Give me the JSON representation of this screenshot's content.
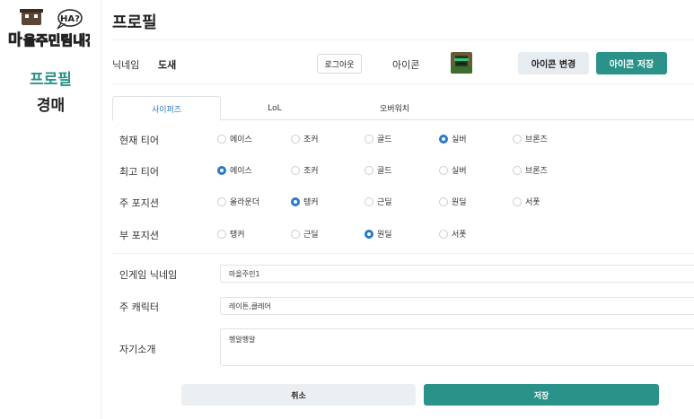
{
  "sidebar": {
    "logo_text": "마을주민팀내전",
    "logo_bubble": "HA?",
    "items": [
      {
        "label": "프로필",
        "active": true
      },
      {
        "label": "경매",
        "active": false
      }
    ],
    "accent": "#2a9288"
  },
  "page": {
    "title": "프로필"
  },
  "profile": {
    "nickname_label": "닉네임",
    "nickname_value": "도새",
    "logout_label": "로그아웃",
    "icon_label": "아이콘",
    "avatar_icon": "character-avatar-icon",
    "change_icon_label": "아이콘 변경",
    "save_icon_label": "아이콘 저장"
  },
  "tabs": [
    {
      "label": "사이퍼즈",
      "active": true
    },
    {
      "label": "LoL",
      "active": false
    },
    {
      "label": "오버워치",
      "active": false
    }
  ],
  "radio_groups": [
    {
      "label": "현재 티어",
      "options": [
        "에이스",
        "조커",
        "골드",
        "실버",
        "브론즈"
      ],
      "selected": "실버"
    },
    {
      "label": "최고 티어",
      "options": [
        "에이스",
        "조커",
        "골드",
        "실버",
        "브론즈"
      ],
      "selected": "에이스"
    },
    {
      "label": "주 포지션",
      "options": [
        "올라운더",
        "탱커",
        "근딜",
        "원딜",
        "서폿"
      ],
      "selected": "탱커"
    },
    {
      "label": "부 포지션",
      "options": [
        "탱커",
        "근딜",
        "원딜",
        "서폿"
      ],
      "selected": "원딜"
    }
  ],
  "fields": {
    "ingame_nick": {
      "label": "인게임 닉네임",
      "value": "마을주민1"
    },
    "main_char": {
      "label": "주 캐릭터",
      "value": "레이튼,클레어"
    },
    "intro": {
      "label": "자기소개",
      "value": "헹알헹알"
    }
  },
  "actions": {
    "cancel_label": "취소",
    "save_label": "저장"
  },
  "colors": {
    "teal": "#2a9288",
    "blue": "#2a78c8"
  }
}
